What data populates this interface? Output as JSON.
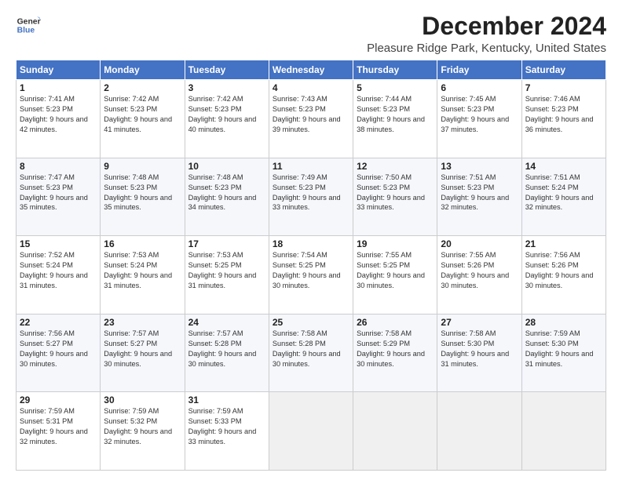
{
  "logo": {
    "line1": "General",
    "line2": "Blue"
  },
  "title": "December 2024",
  "location": "Pleasure Ridge Park, Kentucky, United States",
  "headers": [
    "Sunday",
    "Monday",
    "Tuesday",
    "Wednesday",
    "Thursday",
    "Friday",
    "Saturday"
  ],
  "weeks": [
    [
      {
        "day": "1",
        "sunrise": "Sunrise: 7:41 AM",
        "sunset": "Sunset: 5:23 PM",
        "daylight": "Daylight: 9 hours and 42 minutes."
      },
      {
        "day": "2",
        "sunrise": "Sunrise: 7:42 AM",
        "sunset": "Sunset: 5:23 PM",
        "daylight": "Daylight: 9 hours and 41 minutes."
      },
      {
        "day": "3",
        "sunrise": "Sunrise: 7:42 AM",
        "sunset": "Sunset: 5:23 PM",
        "daylight": "Daylight: 9 hours and 40 minutes."
      },
      {
        "day": "4",
        "sunrise": "Sunrise: 7:43 AM",
        "sunset": "Sunset: 5:23 PM",
        "daylight": "Daylight: 9 hours and 39 minutes."
      },
      {
        "day": "5",
        "sunrise": "Sunrise: 7:44 AM",
        "sunset": "Sunset: 5:23 PM",
        "daylight": "Daylight: 9 hours and 38 minutes."
      },
      {
        "day": "6",
        "sunrise": "Sunrise: 7:45 AM",
        "sunset": "Sunset: 5:23 PM",
        "daylight": "Daylight: 9 hours and 37 minutes."
      },
      {
        "day": "7",
        "sunrise": "Sunrise: 7:46 AM",
        "sunset": "Sunset: 5:23 PM",
        "daylight": "Daylight: 9 hours and 36 minutes."
      }
    ],
    [
      {
        "day": "8",
        "sunrise": "Sunrise: 7:47 AM",
        "sunset": "Sunset: 5:23 PM",
        "daylight": "Daylight: 9 hours and 35 minutes."
      },
      {
        "day": "9",
        "sunrise": "Sunrise: 7:48 AM",
        "sunset": "Sunset: 5:23 PM",
        "daylight": "Daylight: 9 hours and 35 minutes."
      },
      {
        "day": "10",
        "sunrise": "Sunrise: 7:48 AM",
        "sunset": "Sunset: 5:23 PM",
        "daylight": "Daylight: 9 hours and 34 minutes."
      },
      {
        "day": "11",
        "sunrise": "Sunrise: 7:49 AM",
        "sunset": "Sunset: 5:23 PM",
        "daylight": "Daylight: 9 hours and 33 minutes."
      },
      {
        "day": "12",
        "sunrise": "Sunrise: 7:50 AM",
        "sunset": "Sunset: 5:23 PM",
        "daylight": "Daylight: 9 hours and 33 minutes."
      },
      {
        "day": "13",
        "sunrise": "Sunrise: 7:51 AM",
        "sunset": "Sunset: 5:23 PM",
        "daylight": "Daylight: 9 hours and 32 minutes."
      },
      {
        "day": "14",
        "sunrise": "Sunrise: 7:51 AM",
        "sunset": "Sunset: 5:24 PM",
        "daylight": "Daylight: 9 hours and 32 minutes."
      }
    ],
    [
      {
        "day": "15",
        "sunrise": "Sunrise: 7:52 AM",
        "sunset": "Sunset: 5:24 PM",
        "daylight": "Daylight: 9 hours and 31 minutes."
      },
      {
        "day": "16",
        "sunrise": "Sunrise: 7:53 AM",
        "sunset": "Sunset: 5:24 PM",
        "daylight": "Daylight: 9 hours and 31 minutes."
      },
      {
        "day": "17",
        "sunrise": "Sunrise: 7:53 AM",
        "sunset": "Sunset: 5:25 PM",
        "daylight": "Daylight: 9 hours and 31 minutes."
      },
      {
        "day": "18",
        "sunrise": "Sunrise: 7:54 AM",
        "sunset": "Sunset: 5:25 PM",
        "daylight": "Daylight: 9 hours and 30 minutes."
      },
      {
        "day": "19",
        "sunrise": "Sunrise: 7:55 AM",
        "sunset": "Sunset: 5:25 PM",
        "daylight": "Daylight: 9 hours and 30 minutes."
      },
      {
        "day": "20",
        "sunrise": "Sunrise: 7:55 AM",
        "sunset": "Sunset: 5:26 PM",
        "daylight": "Daylight: 9 hours and 30 minutes."
      },
      {
        "day": "21",
        "sunrise": "Sunrise: 7:56 AM",
        "sunset": "Sunset: 5:26 PM",
        "daylight": "Daylight: 9 hours and 30 minutes."
      }
    ],
    [
      {
        "day": "22",
        "sunrise": "Sunrise: 7:56 AM",
        "sunset": "Sunset: 5:27 PM",
        "daylight": "Daylight: 9 hours and 30 minutes."
      },
      {
        "day": "23",
        "sunrise": "Sunrise: 7:57 AM",
        "sunset": "Sunset: 5:27 PM",
        "daylight": "Daylight: 9 hours and 30 minutes."
      },
      {
        "day": "24",
        "sunrise": "Sunrise: 7:57 AM",
        "sunset": "Sunset: 5:28 PM",
        "daylight": "Daylight: 9 hours and 30 minutes."
      },
      {
        "day": "25",
        "sunrise": "Sunrise: 7:58 AM",
        "sunset": "Sunset: 5:28 PM",
        "daylight": "Daylight: 9 hours and 30 minutes."
      },
      {
        "day": "26",
        "sunrise": "Sunrise: 7:58 AM",
        "sunset": "Sunset: 5:29 PM",
        "daylight": "Daylight: 9 hours and 30 minutes."
      },
      {
        "day": "27",
        "sunrise": "Sunrise: 7:58 AM",
        "sunset": "Sunset: 5:30 PM",
        "daylight": "Daylight: 9 hours and 31 minutes."
      },
      {
        "day": "28",
        "sunrise": "Sunrise: 7:59 AM",
        "sunset": "Sunset: 5:30 PM",
        "daylight": "Daylight: 9 hours and 31 minutes."
      }
    ],
    [
      {
        "day": "29",
        "sunrise": "Sunrise: 7:59 AM",
        "sunset": "Sunset: 5:31 PM",
        "daylight": "Daylight: 9 hours and 32 minutes."
      },
      {
        "day": "30",
        "sunrise": "Sunrise: 7:59 AM",
        "sunset": "Sunset: 5:32 PM",
        "daylight": "Daylight: 9 hours and 32 minutes."
      },
      {
        "day": "31",
        "sunrise": "Sunrise: 7:59 AM",
        "sunset": "Sunset: 5:33 PM",
        "daylight": "Daylight: 9 hours and 33 minutes."
      },
      null,
      null,
      null,
      null
    ]
  ]
}
